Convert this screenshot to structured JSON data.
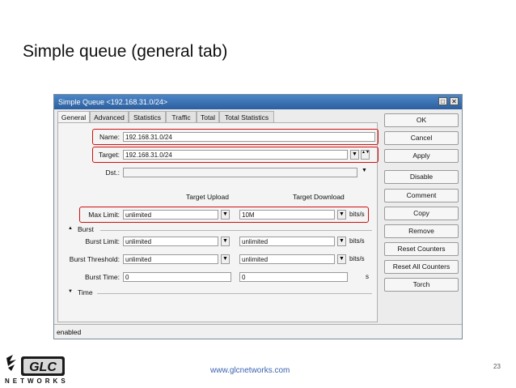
{
  "slide": {
    "title": "Simple queue (general tab)",
    "url": "www.glcnetworks.com",
    "page_number": "23",
    "logo_text": "NETWORKS"
  },
  "window": {
    "title": "Simple Queue <192.168.31.0/24>",
    "tabs": [
      "General",
      "Advanced",
      "Statistics",
      "Traffic",
      "Total",
      "Total Statistics"
    ],
    "active_tab": "General",
    "status": "enabled"
  },
  "general": {
    "name_label": "Name:",
    "name_value": "192.168.31.0/24",
    "target_label": "Target:",
    "target_value": "192.168.31.0/24",
    "dst_label": "Dst.:",
    "dst_value": "",
    "upload_header": "Target Upload",
    "download_header": "Target Download",
    "max_limit_label": "Max Limit:",
    "max_limit_upload": "unlimited",
    "max_limit_download": "10M",
    "unit_bits": "bits/s",
    "unit_s": "s",
    "burst_section": "Burst",
    "burst_limit_label": "Burst Limit:",
    "burst_limit_upload": "unlimited",
    "burst_limit_download": "unlimited",
    "burst_threshold_label": "Burst Threshold:",
    "burst_threshold_upload": "unlimited",
    "burst_threshold_download": "unlimited",
    "burst_time_label": "Burst Time:",
    "burst_time_upload": "0",
    "burst_time_download": "0",
    "time_section": "Time"
  },
  "buttons": [
    "OK",
    "Cancel",
    "Apply",
    "Disable",
    "Comment",
    "Copy",
    "Remove",
    "Reset Counters",
    "Reset All Counters",
    "Torch"
  ],
  "icons": {
    "dropdown": "▼",
    "updown": "▲▼",
    "expand": "▲",
    "collapse": "▼",
    "minimize": "□",
    "close": "✕"
  },
  "colors": {
    "highlight": "#d01010",
    "titlebar": "#2c5f9e",
    "link": "#3a62b0"
  }
}
